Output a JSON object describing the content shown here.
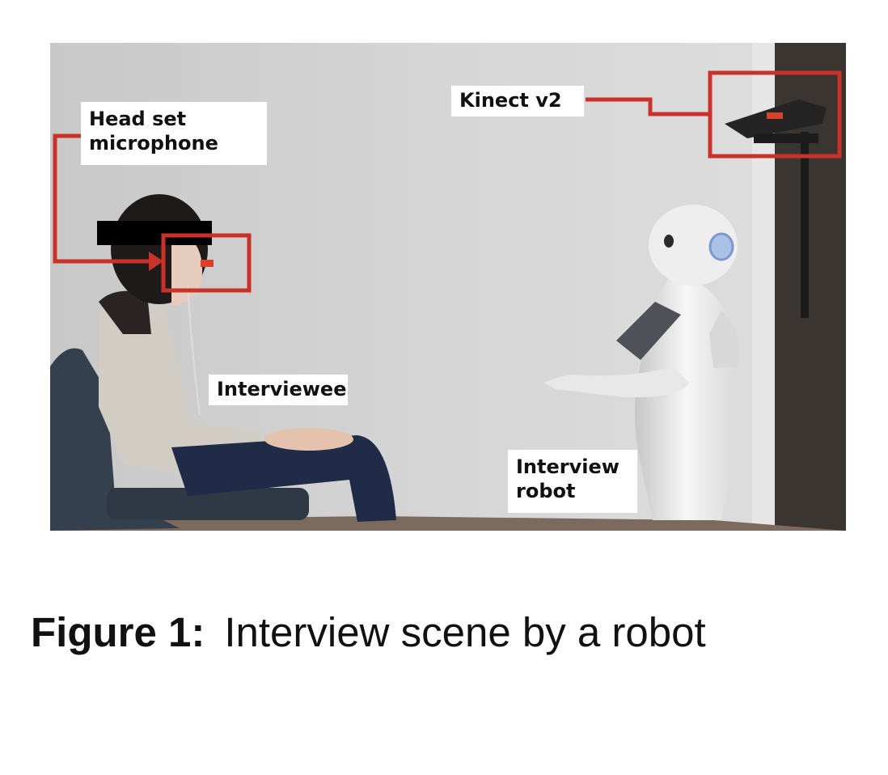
{
  "figure": {
    "callouts": {
      "headset": "Head set\nmicrophone",
      "kinect": "Kinect v2",
      "interviewee": "Interviewee",
      "robot": "Interview\nrobot"
    },
    "highlight_color": "#c8322b",
    "caption_label": "Figure 1:",
    "caption_text": "Interview scene by a robot"
  }
}
